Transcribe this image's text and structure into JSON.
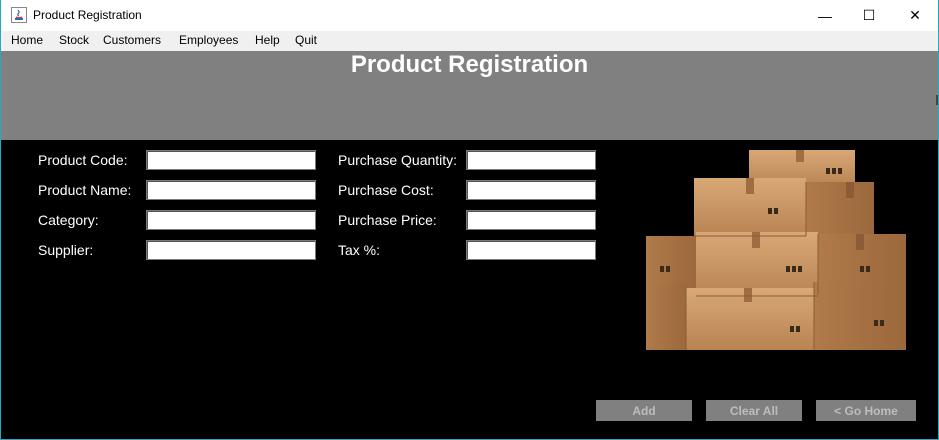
{
  "window": {
    "title": "Product Registration",
    "controls": {
      "minimize": "—",
      "maximize": "☐",
      "close": "✕"
    }
  },
  "menu": [
    "Home",
    "Stock",
    "Customers",
    "Employees",
    "Help",
    "Quit"
  ],
  "header": {
    "title": "Product Registration"
  },
  "form": {
    "left": [
      {
        "label": "Product Code:",
        "value": ""
      },
      {
        "label": "Product Name:",
        "value": ""
      },
      {
        "label": "Category:",
        "value": ""
      },
      {
        "label": "Supplier:",
        "value": ""
      }
    ],
    "right": [
      {
        "label": "Purchase Quantity:",
        "value": ""
      },
      {
        "label": "Purchase Cost:",
        "value": ""
      },
      {
        "label": "Purchase Price:",
        "value": ""
      },
      {
        "label": "Tax %:",
        "value": ""
      }
    ]
  },
  "buttons": {
    "add": "Add",
    "clear": "Clear All",
    "home": "< Go Home"
  },
  "image": {
    "subject": "cardboard-boxes"
  },
  "colors": {
    "header_bg": "#808080",
    "body_bg": "#000000",
    "button_bg": "#808080",
    "window_border": "#2aa6c7"
  }
}
